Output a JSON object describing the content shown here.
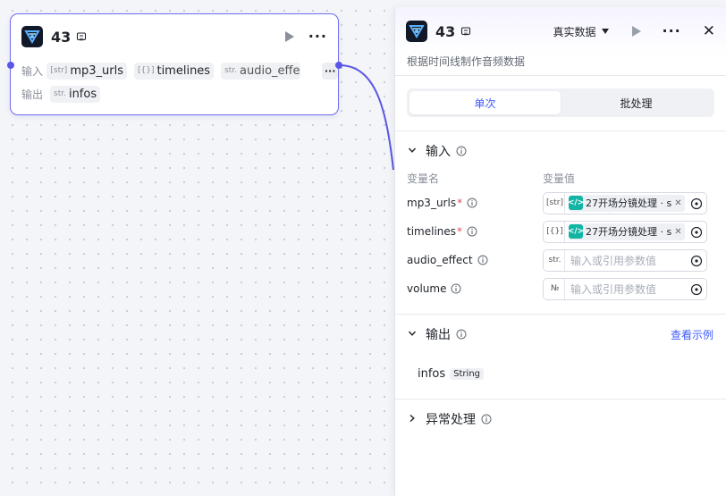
{
  "node": {
    "title": "43",
    "input_label": "输入",
    "output_label": "输出",
    "inputs": [
      {
        "type": "[str]",
        "name": "mp3_urls"
      },
      {
        "type": "[{}]",
        "name": "timelines"
      },
      {
        "type": "str.",
        "name": "audio_effec"
      }
    ],
    "more_inputs": "···",
    "outputs": [
      {
        "type": "str.",
        "name": "infos"
      }
    ]
  },
  "panel": {
    "title": "43",
    "data_mode": "真实数据",
    "description": "根据时间线制作音频数据",
    "tabs": [
      {
        "label": "单次",
        "active": true
      },
      {
        "label": "批处理",
        "active": false
      }
    ],
    "input_section": {
      "title": "输入",
      "col_name": "变量名",
      "col_value": "变量值",
      "rows": [
        {
          "name": "mp3_urls",
          "required": true,
          "type": "[str]",
          "ref": "27开场分镜处理 · s",
          "placeholder": ""
        },
        {
          "name": "timelines",
          "required": true,
          "type": "[{}]",
          "ref": "27开场分镜处理 · s",
          "placeholder": ""
        },
        {
          "name": "audio_effect",
          "required": false,
          "type": "str.",
          "ref": "",
          "placeholder": "输入或引用参数值"
        },
        {
          "name": "volume",
          "required": false,
          "type": "№",
          "ref": "",
          "placeholder": "输入或引用参数值"
        }
      ]
    },
    "output_section": {
      "title": "输出",
      "link": "查看示例",
      "items": [
        {
          "name": "infos",
          "type": "String"
        }
      ]
    },
    "error_section": {
      "title": "异常处理"
    }
  },
  "colors": {
    "accent": "#3d5afe",
    "node_border": "#6e6cf0",
    "edge": "#5a57e6",
    "required": "#e34d59",
    "ref_logo": "#12b5a4"
  }
}
